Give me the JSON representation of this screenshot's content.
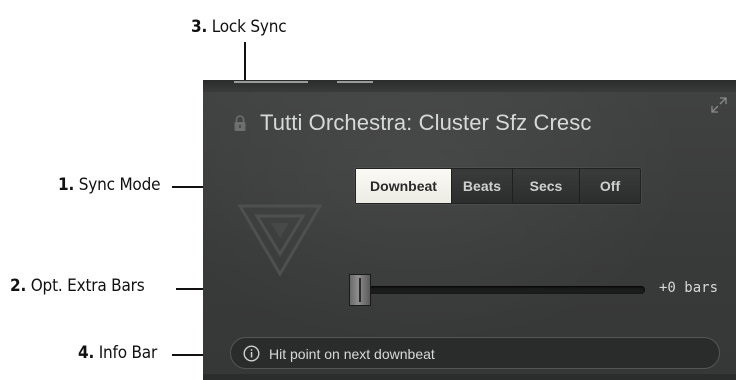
{
  "callouts": {
    "lock_sync": {
      "num": "3.",
      "text": "Lock Sync"
    },
    "sync_mode": {
      "num": "1.",
      "text": "Sync Mode"
    },
    "extra_bars": {
      "num": "2.",
      "text": "Opt. Extra Bars"
    },
    "info_bar": {
      "num": "4.",
      "text": "Info Bar"
    }
  },
  "panel": {
    "title": "Tutti Orchestra: Cluster Sfz Cresc",
    "sync_modes": [
      "Downbeat",
      "Beats",
      "Secs",
      "Off"
    ],
    "active_sync_mode": "Downbeat",
    "extra_bars": {
      "value": 0,
      "label": "+0 bars"
    },
    "info_text": "Hit point on next downbeat"
  },
  "icons": {
    "lock": "lock-icon",
    "expand": "expand-icon",
    "info": "info-icon",
    "logo": "triangle-logo-icon"
  },
  "colors": {
    "panel_bg": "#3c3d3d",
    "active_button": "#fbfaf5",
    "text": "#d8d8d8"
  }
}
